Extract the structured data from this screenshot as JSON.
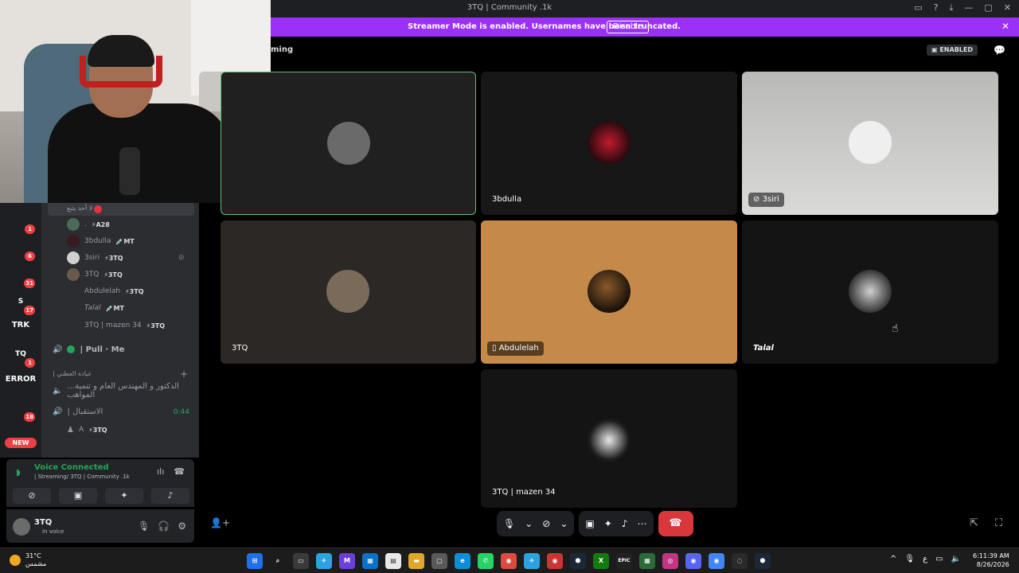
{
  "window": {
    "title": "3TQ | Community .1k",
    "icons": [
      "▭",
      "?",
      "⤓",
      "—",
      "▢",
      "✕"
    ]
  },
  "banner": {
    "message": "Streamer Mode is enabled. Usernames have been truncated.",
    "disable_label": "Disable",
    "close": "✕"
  },
  "servers": [
    {
      "text": "",
      "badge": "1",
      "color": "#4a4d55"
    },
    {
      "text": "",
      "badge": "6",
      "color": "#2b6cc4"
    },
    {
      "text": "",
      "badge": "31",
      "color": "#8c1d1d"
    },
    {
      "text": "S",
      "badge": "17",
      "color": "#1e5aa8"
    },
    {
      "text": "TRK",
      "badge": "",
      "color": "#1e1f22"
    },
    {
      "text": "TQ",
      "badge": "1",
      "color": "#1e1f22"
    },
    {
      "text": "ERROR",
      "badge": "",
      "color": "#1e1f22"
    },
    {
      "text": "",
      "badge": "18",
      "color": "#1e1f22"
    }
  ],
  "new_pill": "NEW",
  "sidebar": {
    "stage_row_text": "لا أحد يتبع",
    "voice_users": [
      {
        "name": ".",
        "tag": "⚡A28",
        "avatar": "#4a6a5a"
      },
      {
        "name": "3bdulla",
        "tag": "💉MT",
        "avatar": "#3a1a1e"
      },
      {
        "name": "3siri",
        "tag": "⚡3TQ",
        "avatar": "#d0d0d0",
        "muted": "⊘"
      },
      {
        "name": "3TQ",
        "tag": "⚡3TQ",
        "avatar": "#6b5a4a"
      },
      {
        "name": "Abdulelah",
        "tag": "⚡3TQ",
        "avatar": "#2b2d31"
      },
      {
        "name": "Talal",
        "tag": "💉MT",
        "avatar": "#2b2d31"
      },
      {
        "name": "3TQ | mazen 34",
        "tag": "⚡3TQ",
        "avatar": "#2b2d31"
      }
    ],
    "pull_me": "| Pull · Me",
    "category": "| عيادة العطني",
    "channel_long": "...الدكتور و المهندس العام و تنمية المواهب",
    "channel_istiqbal": "| الاستقبال",
    "istiqbal_timer": "0:44",
    "istiqbal_user": {
      "name": "A",
      "tag": "⚡3TQ"
    }
  },
  "voice_panel": {
    "title": "Voice Connected",
    "subtitle": "| Streaming/ 3TQ | Community .1k"
  },
  "user_panel": {
    "name": "3TQ",
    "status": "In voice"
  },
  "stage": {
    "title": "ming",
    "enabled_label": "ENABLED"
  },
  "tiles": [
    {
      "name": "",
      "avatar": "#6a6a6a"
    },
    {
      "name": "3bdulla",
      "avatar": "#5a1a22"
    },
    {
      "name": "3siri",
      "avatar": "#e8e8e8"
    },
    {
      "name": "3TQ",
      "avatar": "#7a6a5a"
    },
    {
      "name": "Abdulelah",
      "avatar": "#3a2a1a"
    },
    {
      "name": "Talal",
      "avatar": "#2a2a2a"
    },
    {
      "name": "3TQ | mazen 34",
      "avatar": "#1a1a1a"
    }
  ],
  "taskbar": {
    "temperature": "31°C",
    "weather_text": "مشمس",
    "tray_lang": "ع",
    "time": "6:11:39 AM",
    "date": "8/26/2026",
    "apps": [
      {
        "label": "⊞",
        "color": "#1f6feb"
      },
      {
        "label": "⌕",
        "color": "#1c1c1c"
      },
      {
        "label": "▭",
        "color": "#3a3a3a"
      },
      {
        "label": "✈",
        "color": "#2aa3e0"
      },
      {
        "label": "M",
        "color": "#6a3fd8"
      },
      {
        "label": "▦",
        "color": "#0a72c9"
      },
      {
        "label": "▤",
        "color": "#e8e8e8"
      },
      {
        "label": "▬",
        "color": "#e0a82a"
      },
      {
        "label": "▢",
        "color": "#5a5a5a"
      },
      {
        "label": "e",
        "color": "#0c8fd6"
      },
      {
        "label": "✆",
        "color": "#25d366"
      },
      {
        "label": "◉",
        "color": "#dd4b3e"
      },
      {
        "label": "✈",
        "color": "#2aa3e0"
      },
      {
        "label": "◉",
        "color": "#cc3333"
      },
      {
        "label": "⬢",
        "color": "#1b2838"
      },
      {
        "label": "X",
        "color": "#107c10"
      },
      {
        "label": "EPIC",
        "color": "#222222"
      },
      {
        "label": "▦",
        "color": "#2d6a3a"
      },
      {
        "label": "◎",
        "color": "#c13584"
      },
      {
        "label": "◉",
        "color": "#5865f2"
      },
      {
        "label": "◉",
        "color": "#4285f4"
      },
      {
        "label": "◌",
        "color": "#2a2a2a"
      },
      {
        "label": "⬢",
        "color": "#1b2838"
      }
    ]
  }
}
